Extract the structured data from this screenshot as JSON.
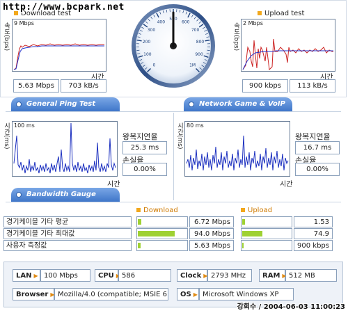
{
  "watermark": "http://www.bcpark.net",
  "download": {
    "title": "Download test",
    "ylabel": "속도(bps)",
    "scale": "9 Mbps",
    "xlabel": "시간",
    "value_mbps": "5.63 Mbps",
    "value_kbs": "703 kB/s"
  },
  "upload": {
    "title": "Upload test",
    "ylabel": "속도(bps)",
    "scale": "2 Mbps",
    "xlabel": "시간",
    "value_kbps": "900 kbps",
    "value_kbs": "113 kB/s"
  },
  "gauge": {
    "ticks": [
      "0",
      "100",
      "200",
      "300",
      "400",
      "500",
      "600",
      "700",
      "800",
      "900",
      "1M"
    ]
  },
  "tabs": {
    "ping": "General Ping Test",
    "game": "Network Game & VoIP Test",
    "bandwidth": "Bandwidth Gauge"
  },
  "ping": {
    "ylabel": "시간(ms)",
    "scale": "100 ms",
    "xlabel": "시간",
    "rtt_label": "왕복지연율",
    "rtt_value": "25.3 ms",
    "loss_label": "손실율",
    "loss_value": "0.00%"
  },
  "game": {
    "ylabel": "시간(ms)",
    "scale": "80 ms",
    "xlabel": "시간",
    "rtt_label": "왕복지연율",
    "rtt_value": "16.7 ms",
    "loss_label": "손실율",
    "loss_value": "0.00%"
  },
  "bandwidth": {
    "download_header": "Download",
    "upload_header": "Upload",
    "rows": [
      {
        "label": "경기케이블 기타 평균",
        "down": "6.72 Mbps",
        "down_frac": 0.07,
        "up": "1.53 Mbps",
        "up_frac": 0.05
      },
      {
        "label": "경기케이블 기타 최대값",
        "down": "94.0 Mbps",
        "down_frac": 0.75,
        "up": "74.9 Mbps",
        "up_frac": 0.42
      },
      {
        "label": "사용자 측정값",
        "down": "5.63 Mbps",
        "down_frac": 0.05,
        "up": "900 kbps",
        "up_frac": 0.03
      }
    ]
  },
  "info": {
    "lan_label": "LAN",
    "lan_value": "100 Mbps",
    "cpu_label": "CPU",
    "cpu_value": "586",
    "clock_label": "Clock",
    "clock_value": "2793 MHz",
    "ram_label": "RAM",
    "ram_value": "512 MB",
    "browser_label": "Browser",
    "browser_value": "Mozilla/4.0 (compatible; MSIE 6.0",
    "os_label": "OS",
    "os_value": "Microsoft Windows XP"
  },
  "footer_stamp": "강희수 / 2004-06-03 11:00:23"
}
